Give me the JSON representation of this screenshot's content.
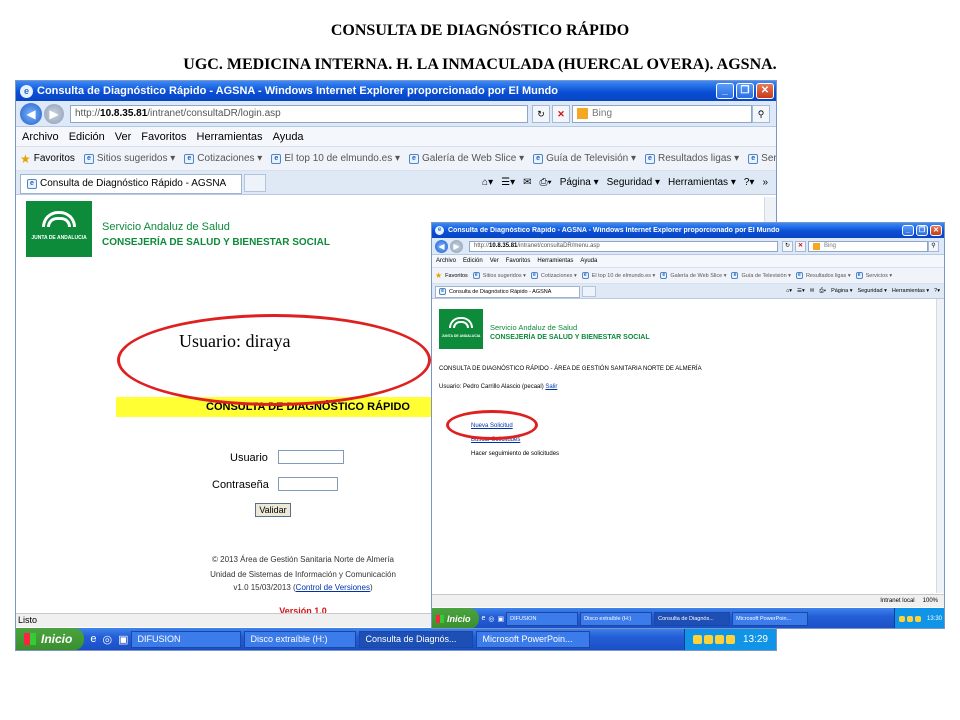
{
  "slide": {
    "title": "CONSULTA DE DIAGNÓSTICO RÁPIDO",
    "subtitle": "UGC. MEDICINA INTERNA. H. LA INMACULADA (HUERCAL OVERA). AGSNA."
  },
  "annotation_text": "Usuario: diraya",
  "accent_colors": {
    "ellipse": "#e02020",
    "sas_green": "#0d8a3a",
    "band_yellow": "#ffff33",
    "version_red": "#d41414"
  },
  "window1": {
    "title": "Consulta de Diagnóstico Rápido - AGSNA - Windows Internet Explorer proporcionado por El Mundo",
    "address_prefix": "http://",
    "address_host": "10.8.35.81",
    "address_path": "/intranet/consultaDR/login.asp",
    "search_placeholder": "Bing",
    "menu": [
      "Archivo",
      "Edición",
      "Ver",
      "Favoritos",
      "Herramientas",
      "Ayuda"
    ],
    "favorites_label": "Favoritos",
    "favorites_items": [
      "Sitios sugeridos ▾",
      "Cotizaciones ▾",
      "El top 10 de elmundo.es ▾",
      "Galería de Web Slice ▾",
      "Guía de Televisión ▾",
      "Resultados ligas ▾",
      "Servicios ▾"
    ],
    "tab_label": "Consulta de Diagnóstico Rápido - AGSNA",
    "cmd": {
      "page": "Página ▾",
      "security": "Seguridad ▾",
      "tools": "Herramientas ▾",
      "more": "»"
    },
    "sas_title": "Servicio Andaluz de Salud",
    "sas_subtitle": "CONSEJERÍA DE SALUD Y BIENESTAR SOCIAL",
    "logo_text": "JUNTA DE ANDALUCIA",
    "band_title": "CONSULTA DE DIAGNÓSTICO RÁPIDO",
    "user_label": "Usuario",
    "password_label": "Contraseña",
    "user_value": "",
    "password_value": "",
    "submit_label": "Validar",
    "footer_copy": "© 2013 Área de Gestión Sanitaria Norte de Almería",
    "footer_unit": "Unidad de Sistemas de Información y Comunicación",
    "footer_version_prefix": "v1.0 15/03/2013 (",
    "footer_version_link": "Control de Versiones",
    "footer_version_suffix": ")",
    "version": "Versión 1.0",
    "status": "Listo",
    "taskbar": {
      "start": "Inicio",
      "items": [
        "DIFUSION",
        "Disco extraíble (H:)",
        "Consulta de Diagnós...",
        "Microsoft PowerPoin..."
      ],
      "clock": "13:29"
    }
  },
  "window2": {
    "title": "Consulta de Diagnóstico Rápido - AGSNA - Windows Internet Explorer proporcionado por El Mundo",
    "address_prefix": "http://",
    "address_host": "10.8.35.81",
    "address_path": "/intranet/consultaDR/menu.asp",
    "search_placeholder": "Bing",
    "menu": [
      "Archivo",
      "Edición",
      "Ver",
      "Favoritos",
      "Herramientas",
      "Ayuda"
    ],
    "favorites_label": "Favoritos",
    "favorites_items": [
      "Sitios sugeridos ▾",
      "Cotizaciones ▾",
      "El top 10 de elmundo.es ▾",
      "Galería de Web Slice ▾",
      "Guía de Televisión ▾",
      "Resultados ligas ▾",
      "Servicios ▾"
    ],
    "tab_label": "Consulta de Diagnóstico Rápido - AGSNA",
    "cmd": {
      "page": "Página ▾",
      "security": "Seguridad ▾",
      "tools": "Herramientas ▾"
    },
    "sas_title": "Servicio Andaluz de Salud",
    "sas_subtitle": "CONSEJERÍA DE SALUD Y BIENESTAR SOCIAL",
    "logo_text": "JUNTA DE ANDALUCIA",
    "heading": "CONSULTA DE DIAGNÓSTICO RÁPIDO - ÁREA DE GESTIÓN SANITARIA NORTE DE ALMERÍA",
    "user_line": "Usuario: Pedro Carrillo Alascio (pecaal)",
    "logout_link": "Salir",
    "menu_links": [
      "Nueva Solicitud",
      "Buscar Solicitudes"
    ],
    "follow_up": "Hacer seguimiento de solicitudes",
    "status_zone": "Intranet local",
    "zoom": "100%",
    "taskbar": {
      "start": "Inicio",
      "items": [
        "DIFUSION",
        "Disco extraíble (H:)",
        "Consulta de Diagnós...",
        "Microsoft PowerPoin..."
      ],
      "clock": "13:30"
    }
  }
}
